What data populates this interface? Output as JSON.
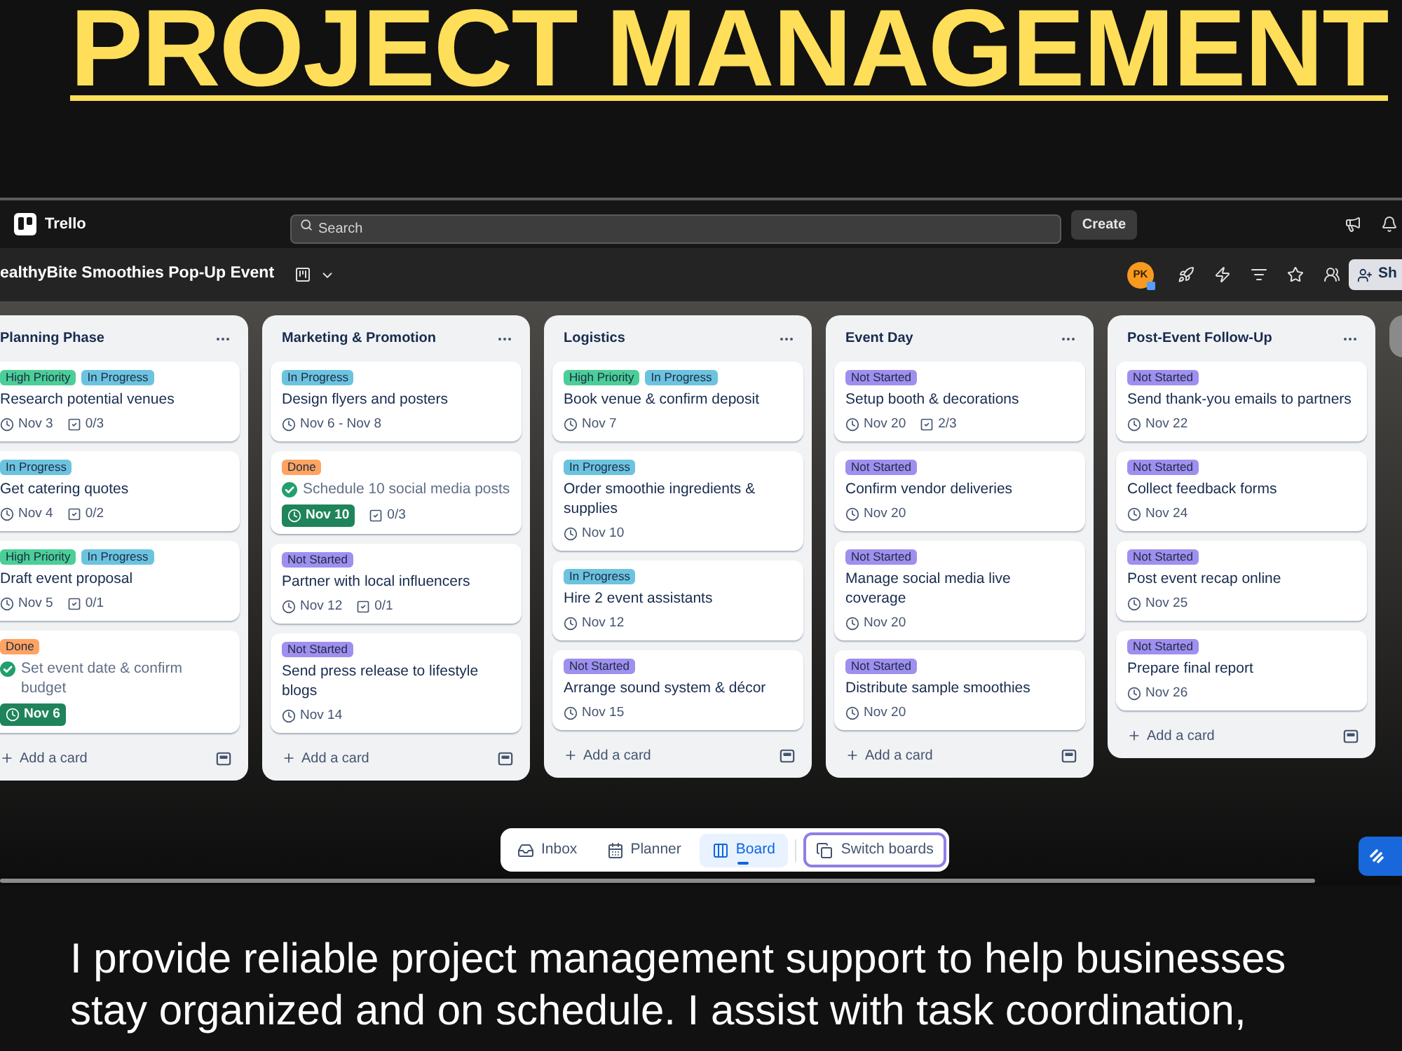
{
  "headline": "PROJECT MANAGEMENT",
  "app_bar": {
    "logo": "Trello",
    "search": {
      "placeholder": "Search"
    },
    "create_button": "Create"
  },
  "board_bar": {
    "title": "ealthyBite Smoothies Pop-Up Event",
    "avatar": "PK",
    "share_button": "Sh"
  },
  "lists": [
    {
      "title": "Planning Phase",
      "cards": [
        {
          "labels": [
            {
              "text": "High Priority",
              "color": "#4bce97"
            },
            {
              "text": "In Progress",
              "color": "#6cc3e0"
            }
          ],
          "title": "Research potential venues",
          "date": "Nov 3",
          "checklist": "0/3",
          "done": false
        },
        {
          "labels": [
            {
              "text": "In Progress",
              "color": "#6cc3e0"
            }
          ],
          "title": "Get catering quotes",
          "date": "Nov 4",
          "checklist": "0/2",
          "done": false
        },
        {
          "labels": [
            {
              "text": "High Priority",
              "color": "#4bce97"
            },
            {
              "text": "In Progress",
              "color": "#6cc3e0"
            }
          ],
          "title": "Draft event proposal",
          "date": "Nov 5",
          "checklist": "0/1",
          "done": false
        },
        {
          "labels": [
            {
              "text": "Done",
              "color": "#fea362"
            }
          ],
          "title": "Set event date & confirm budget",
          "date": "Nov 6",
          "done": true
        }
      ],
      "add_card": "Add a card"
    },
    {
      "title": "Marketing & Promotion",
      "cards": [
        {
          "labels": [
            {
              "text": "In Progress",
              "color": "#6cc3e0"
            }
          ],
          "title": "Design flyers and posters",
          "date": "Nov 6 - Nov 8",
          "done": false
        },
        {
          "labels": [
            {
              "text": "Done",
              "color": "#fea362"
            }
          ],
          "title": "Schedule 10 social media posts",
          "date": "Nov 10",
          "checklist": "0/3",
          "done": true
        },
        {
          "labels": [
            {
              "text": "Not Started",
              "color": "#9f8fef"
            }
          ],
          "title": "Partner with local influencers",
          "date": "Nov 12",
          "checklist": "0/1",
          "done": false
        },
        {
          "labels": [
            {
              "text": "Not Started",
              "color": "#9f8fef"
            }
          ],
          "title": "Send press release to lifestyle blogs",
          "date": "Nov 14",
          "done": false
        }
      ],
      "add_card": "Add a card"
    },
    {
      "title": "Logistics",
      "cards": [
        {
          "labels": [
            {
              "text": "High Priority",
              "color": "#4bce97"
            },
            {
              "text": "In Progress",
              "color": "#6cc3e0"
            }
          ],
          "title": "Book venue & confirm deposit",
          "date": "Nov 7",
          "done": false
        },
        {
          "labels": [
            {
              "text": "In Progress",
              "color": "#6cc3e0"
            }
          ],
          "title": "Order smoothie ingredients & supplies",
          "date": "Nov 10",
          "done": false
        },
        {
          "labels": [
            {
              "text": "In Progress",
              "color": "#6cc3e0"
            }
          ],
          "title": "Hire 2 event assistants",
          "date": "Nov 12",
          "done": false
        },
        {
          "labels": [
            {
              "text": "Not Started",
              "color": "#9f8fef"
            }
          ],
          "title": "Arrange sound system & décor",
          "date": "Nov 15",
          "done": false
        }
      ],
      "add_card": "Add a card"
    },
    {
      "title": "Event Day",
      "cards": [
        {
          "labels": [
            {
              "text": "Not Started",
              "color": "#9f8fef"
            }
          ],
          "title": "Setup booth & decorations",
          "date": "Nov 20",
          "checklist": "2/3",
          "done": false
        },
        {
          "labels": [
            {
              "text": "Not Started",
              "color": "#9f8fef"
            }
          ],
          "title": "Confirm vendor deliveries",
          "date": "Nov 20",
          "done": false
        },
        {
          "labels": [
            {
              "text": "Not Started",
              "color": "#9f8fef"
            }
          ],
          "title": "Manage social media live coverage",
          "date": "Nov 20",
          "done": false
        },
        {
          "labels": [
            {
              "text": "Not Started",
              "color": "#9f8fef"
            }
          ],
          "title": "Distribute sample smoothies",
          "date": "Nov 20",
          "done": false
        }
      ],
      "add_card": "Add a card"
    },
    {
      "title": "Post-Event Follow-Up",
      "cards": [
        {
          "labels": [
            {
              "text": "Not Started",
              "color": "#9f8fef"
            }
          ],
          "title": "Send thank-you emails to partners",
          "date": "Nov 22",
          "done": false
        },
        {
          "labels": [
            {
              "text": "Not Started",
              "color": "#9f8fef"
            }
          ],
          "title": "Collect feedback forms",
          "date": "Nov 24",
          "done": false
        },
        {
          "labels": [
            {
              "text": "Not Started",
              "color": "#9f8fef"
            }
          ],
          "title": "Post event recap online",
          "date": "Nov 25",
          "done": false
        },
        {
          "labels": [
            {
              "text": "Not Started",
              "color": "#9f8fef"
            }
          ],
          "title": "Prepare final report",
          "date": "Nov 26",
          "done": false
        }
      ],
      "add_card": "Add a card"
    }
  ],
  "bottom_nav": {
    "items": [
      {
        "label": "Inbox",
        "selected": false
      },
      {
        "label": "Planner",
        "selected": false
      },
      {
        "label": "Board",
        "selected": true
      }
    ],
    "switch_button": "Switch boards"
  },
  "description": "I provide reliable project management support to help businesses stay organized and on schedule. I assist with task coordination,"
}
